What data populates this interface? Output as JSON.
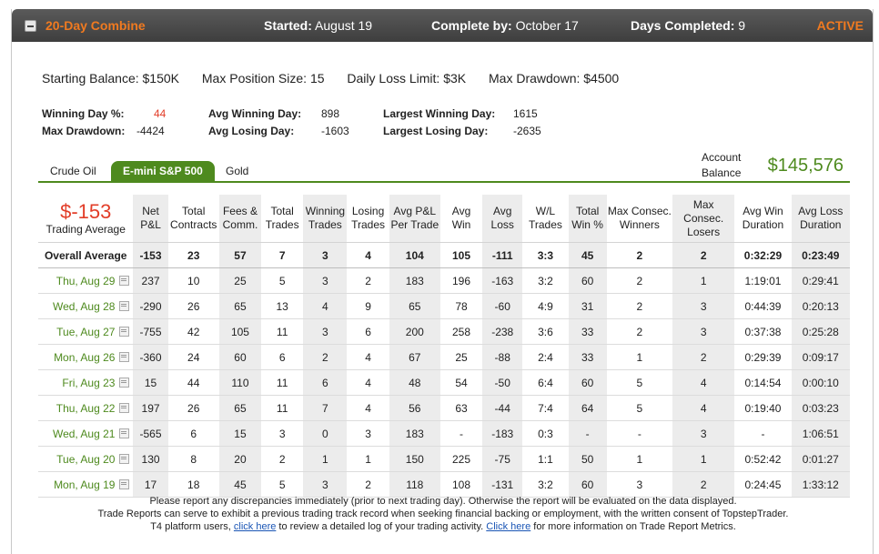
{
  "header": {
    "title": "20-Day Combine",
    "started_label": "Started",
    "started_value": "August 19",
    "complete_label": "Complete by",
    "complete_value": "October 17",
    "days_label": "Days Completed",
    "days_value": "9",
    "status": "ACTIVE"
  },
  "summary": {
    "starting_balance": "Starting Balance: $150K",
    "max_position": "Max Position Size: 15",
    "daily_loss": "Daily Loss Limit: $3K",
    "max_drawdown": "Max Drawdown: $4500"
  },
  "stats": {
    "winning_day_pct_label": "Winning Day %:",
    "winning_day_pct_value": "44",
    "max_drawdown_label": "Max Drawdown:",
    "max_drawdown_value": "-4424",
    "avg_winning_day_label": "Avg Winning Day:",
    "avg_winning_day_value": "898",
    "avg_losing_day_label": "Avg Losing Day:",
    "avg_losing_day_value": "-1603",
    "largest_winning_day_label": "Largest Winning Day:",
    "largest_winning_day_value": "1615",
    "largest_losing_day_label": "Largest Losing Day:",
    "largest_losing_day_value": "-2635"
  },
  "tabs": [
    "Crude Oil",
    "E-mini S&P 500",
    "Gold"
  ],
  "active_tab": "E-mini S&P 500",
  "account": {
    "label": "Account Balance",
    "value": "$145,576"
  },
  "table": {
    "pnl_big": "$-153",
    "pnl_small": "Trading Average",
    "headers": [
      "Net P&L",
      "Total Contracts",
      "Fees & Comm.",
      "Total Trades",
      "Winning Trades",
      "Losing Trades",
      "Avg P&L Per Trade",
      "Avg Win",
      "Avg Loss",
      "W/L Trades",
      "Total Win %",
      "Max Consec. Winners",
      "Max Consec. Losers",
      "Avg Win Duration",
      "Avg Loss Duration"
    ],
    "average": {
      "label": "Overall Average",
      "cells": [
        "-153",
        "23",
        "57",
        "7",
        "3",
        "4",
        "104",
        "105",
        "-111",
        "3:3",
        "45",
        "2",
        "2",
        "0:32:29",
        "0:23:49"
      ]
    },
    "rows": [
      {
        "date": "Thu, Aug 29",
        "cells": [
          "237",
          "10",
          "25",
          "5",
          "3",
          "2",
          "183",
          "196",
          "-163",
          "3:2",
          "60",
          "2",
          "1",
          "1:19:01",
          "0:29:41"
        ]
      },
      {
        "date": "Wed, Aug 28",
        "cells": [
          "-290",
          "26",
          "65",
          "13",
          "4",
          "9",
          "65",
          "78",
          "-60",
          "4:9",
          "31",
          "2",
          "3",
          "0:44:39",
          "0:20:13"
        ]
      },
      {
        "date": "Tue, Aug 27",
        "cells": [
          "-755",
          "42",
          "105",
          "11",
          "3",
          "6",
          "200",
          "258",
          "-238",
          "3:6",
          "33",
          "2",
          "3",
          "0:37:38",
          "0:25:28"
        ]
      },
      {
        "date": "Mon, Aug 26",
        "cells": [
          "-360",
          "24",
          "60",
          "6",
          "2",
          "4",
          "67",
          "25",
          "-88",
          "2:4",
          "33",
          "1",
          "2",
          "0:29:39",
          "0:09:17"
        ]
      },
      {
        "date": "Fri, Aug 23",
        "cells": [
          "15",
          "44",
          "110",
          "11",
          "6",
          "4",
          "48",
          "54",
          "-50",
          "6:4",
          "60",
          "5",
          "4",
          "0:14:54",
          "0:00:10"
        ]
      },
      {
        "date": "Thu, Aug 22",
        "cells": [
          "197",
          "26",
          "65",
          "11",
          "7",
          "4",
          "56",
          "63",
          "-44",
          "7:4",
          "64",
          "5",
          "4",
          "0:19:40",
          "0:03:23"
        ]
      },
      {
        "date": "Wed, Aug 21",
        "cells": [
          "-565",
          "6",
          "15",
          "3",
          "0",
          "3",
          "183",
          "-",
          "-183",
          "0:3",
          "-",
          "-",
          "3",
          "-",
          "1:06:51"
        ]
      },
      {
        "date": "Tue, Aug 20",
        "cells": [
          "130",
          "8",
          "20",
          "2",
          "1",
          "1",
          "150",
          "225",
          "-75",
          "1:1",
          "50",
          "1",
          "1",
          "0:52:42",
          "0:01:27"
        ]
      },
      {
        "date": "Mon, Aug 19",
        "cells": [
          "17",
          "18",
          "45",
          "5",
          "3",
          "2",
          "118",
          "108",
          "-131",
          "3:2",
          "60",
          "3",
          "2",
          "0:24:45",
          "1:33:12"
        ]
      }
    ]
  },
  "footer": {
    "line1": "Please report any discrepancies immediately (prior to next trading day). Otherwise the report will be evaluated on the data displayed.",
    "line2": "Trade Reports can serve to exhibit a previous trading track record when seeking financial backing or employment, with the written consent of TopstepTrader.",
    "line3_pre": "T4 platform users,",
    "link1": "click here",
    "line3_mid": "to review a detailed log of your trading activity.",
    "link2": "Click here",
    "line3_post": "for more information on Trade Report Metrics."
  }
}
